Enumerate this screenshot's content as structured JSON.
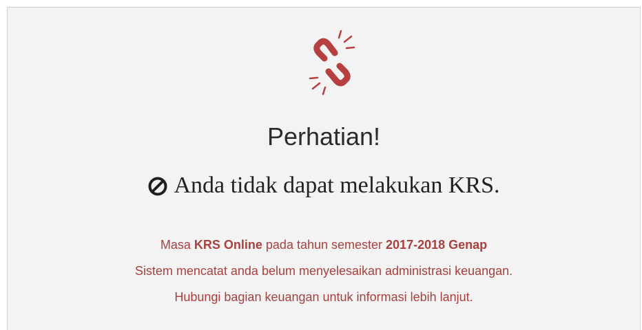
{
  "icons": {
    "broken_link": "broken-link-icon",
    "ban": "ban-icon"
  },
  "colors": {
    "accent": "#b5403f",
    "message_text": "#a8413e",
    "panel_background": "#f3f3f3"
  },
  "alert": {
    "title": "Perhatian!",
    "subtitle": "Anda tidak dapat melakukan KRS.",
    "line1": {
      "prefix": "Masa ",
      "krs_label": "KRS Online",
      "middle": " pada tahun semester ",
      "semester": "2017-2018 Genap"
    },
    "line2": "Sistem mencatat anda belum menyelesaikan administrasi keuangan.",
    "line3": "Hubungi bagian keuangan untuk informasi lebih lanjut."
  }
}
